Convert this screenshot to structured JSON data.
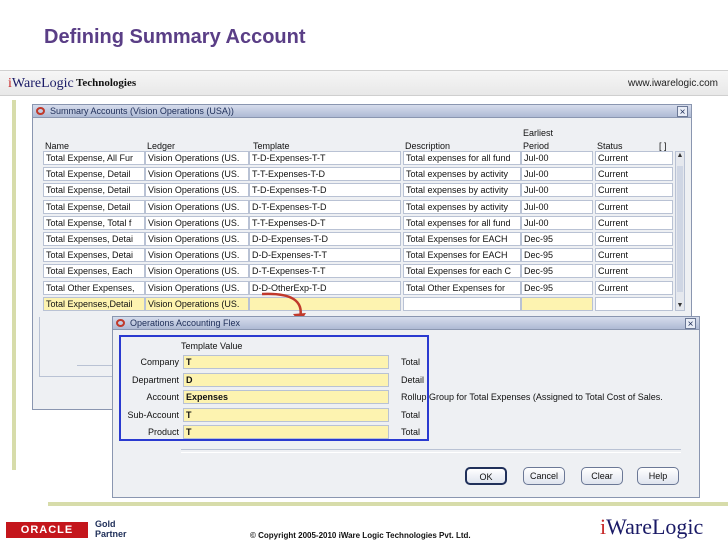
{
  "slide": {
    "title": "Defining Summary Account",
    "brand_i": "i",
    "brand_rest": "WareLogic",
    "brand_tech": "Technologies",
    "url": "www.iwarelogic.com"
  },
  "summary_window": {
    "title": "Summary Accounts (Vision Operations (USA))",
    "close_label": "×",
    "bracket_label": "[ ]",
    "headers": {
      "name": "Name",
      "ledger": "Ledger",
      "template": "Template",
      "description": "Description",
      "earliest_line1": "Earliest",
      "earliest_line2": "Period",
      "status": "Status"
    },
    "rows": [
      {
        "name": "Total Expense, All Fur",
        "ledger": "Vision Operations (US.",
        "template": "T-D-Expenses-T-T",
        "description": "Total expenses for all fund",
        "period": "Jul-00",
        "status": "Current"
      },
      {
        "name": "Total Expense, Detail",
        "ledger": "Vision Operations (US.",
        "template": "T-T-Expenses-T-D",
        "description": "Total expenses by activity",
        "period": "Jul-00",
        "status": "Current"
      },
      {
        "name": "Total Expense, Detail",
        "ledger": "Vision Operations (US.",
        "template": "T-D-Expenses-T-D",
        "description": "Total expenses by activity",
        "period": "Jul-00",
        "status": "Current"
      },
      {
        "name": "Total Expense, Detail",
        "ledger": "Vision Operations (US.",
        "template": "D-T-Expenses-T-D",
        "description": "Total expenses by activity",
        "period": "Jul-00",
        "status": "Current"
      },
      {
        "name": "Total Expense, Total f",
        "ledger": "Vision Operations (US.",
        "template": "T-T-Expenses-D-T",
        "description": "Total expenses for all fund",
        "period": "Jul-00",
        "status": "Current"
      },
      {
        "name": "Total Expenses, Detai",
        "ledger": "Vision Operations (US.",
        "template": "D-D-Expenses-T-D",
        "description": "Total Expenses for EACH",
        "period": "Dec-95",
        "status": "Current"
      },
      {
        "name": "Total Expenses, Detai",
        "ledger": "Vision Operations (US.",
        "template": "D-D-Expenses-T-T",
        "description": "Total Expenses for EACH",
        "period": "Dec-95",
        "status": "Current"
      },
      {
        "name": "Total Expenses, Each",
        "ledger": "Vision Operations (US.",
        "template": "D-T-Expenses-T-T",
        "description": "Total Expenses for each C",
        "period": "Dec-95",
        "status": "Current"
      },
      {
        "name": "Total Other Expenses,",
        "ledger": "Vision Operations (US.",
        "template": "D-D-OtherExp-T-D",
        "description": "Total Other Expenses for",
        "period": "Dec-95",
        "status": "Current"
      },
      {
        "name": "Total Expenses,Detail",
        "ledger": "Vision Operations (US.",
        "template": "",
        "description": "",
        "period": "",
        "status": ""
      }
    ]
  },
  "flex_window": {
    "title": "Operations Accounting Flex",
    "close_label": "×",
    "column_header": "Template Value",
    "segments": [
      {
        "label": "Company",
        "value": "T",
        "desc": "Total"
      },
      {
        "label": "Department",
        "value": "D",
        "desc": "Detail"
      },
      {
        "label": "Account",
        "value": "Expenses",
        "desc": "Rollup Group for Total Expenses (Assigned to Total Cost of Sales."
      },
      {
        "label": "Sub-Account",
        "value": "T",
        "desc": "Total"
      },
      {
        "label": "Product",
        "value": "T",
        "desc": "Total"
      }
    ],
    "buttons": {
      "ok": "OK",
      "cancel": "Cancel",
      "clear": "Clear",
      "help": "Help"
    }
  },
  "footer": {
    "oracle": "ORACLE",
    "gold_line1": "Gold",
    "gold_line2": "Partner",
    "copyright": "© Copyright 2005-2010 iWare Logic Technologies Pvt. Ltd.",
    "logo_i": "i",
    "logo_rest": "WareLogic"
  },
  "colors": {
    "title": "#5a3e86",
    "selected_row": "#fdf3b0",
    "focus_box": "#2a3ad0",
    "arrow": "#c0392b",
    "oracle_red": "#c4161c"
  }
}
